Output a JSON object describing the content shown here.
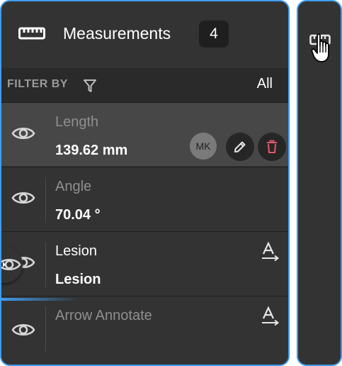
{
  "header": {
    "title": "Measurements",
    "count": "4"
  },
  "filter": {
    "label": "FILTER BY",
    "value": "All"
  },
  "items": [
    {
      "label": "Length",
      "value": "139.62 mm",
      "avatar": "MK",
      "selected": true
    },
    {
      "label": "Angle",
      "value": "70.04 °"
    },
    {
      "label": "Lesion",
      "value": "Lesion"
    },
    {
      "label": "Arrow Annotate",
      "value": ""
    }
  ],
  "colors": {
    "accent": "#3e9cf0",
    "panel_bg": "#333333",
    "selected_row": "#474747",
    "delete": "#e05a6a"
  },
  "icons": {
    "ruler": "ruler-icon",
    "filter": "filter-icon",
    "eye": "eye-icon",
    "edit": "pencil-icon",
    "delete": "trash-icon",
    "text_annotation": "text-annotation-icon",
    "cursor": "hand-pointer-icon"
  }
}
